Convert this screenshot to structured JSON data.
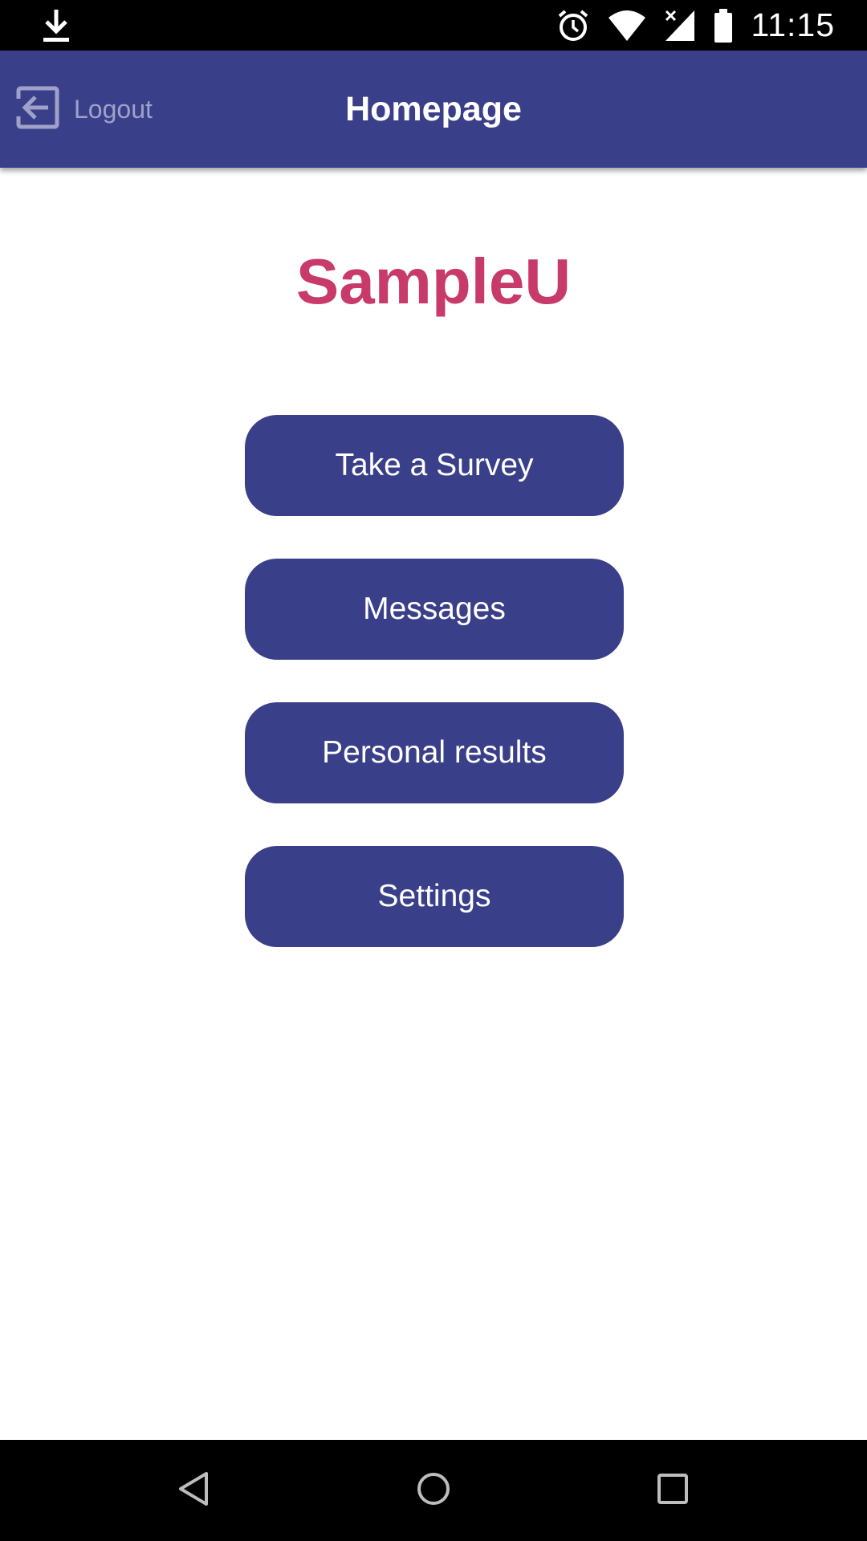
{
  "status_bar": {
    "time": "11:15",
    "icons": [
      "download-icon",
      "alarm-icon",
      "wifi-icon",
      "signal-icon",
      "battery-icon"
    ]
  },
  "app_bar": {
    "logout_label": "Logout",
    "title": "Homepage",
    "color": "#3a3f89"
  },
  "main": {
    "brand": "SampleU",
    "brand_color": "#c73a6a",
    "buttons": [
      {
        "label": "Take a Survey"
      },
      {
        "label": "Messages"
      },
      {
        "label": "Personal results"
      },
      {
        "label": "Settings"
      }
    ]
  },
  "nav_bar": {
    "icons": [
      "back-icon",
      "home-icon",
      "recents-icon"
    ]
  }
}
